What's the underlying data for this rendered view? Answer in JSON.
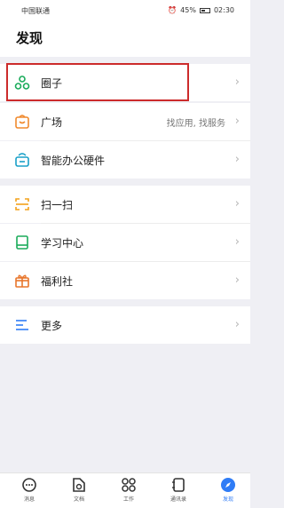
{
  "status_bar": {
    "carrier": "中国联通",
    "battery": "45%",
    "time": "02:30"
  },
  "header": {
    "title": "发现"
  },
  "items": [
    {
      "label": "圈子",
      "icon": "circle-group-icon",
      "color": "#1aab5a"
    },
    {
      "label": "广场",
      "icon": "square-bag-icon",
      "color": "#f08a2e",
      "hint": "找应用, 找服务"
    },
    {
      "label": "智能办公硬件",
      "icon": "smart-hardware-icon",
      "color": "#1aa0c8"
    },
    {
      "label": "扫一扫",
      "icon": "scan-icon",
      "color": "#f3a21b"
    },
    {
      "label": "学习中心",
      "icon": "book-icon",
      "color": "#1aab5a"
    },
    {
      "label": "福利社",
      "icon": "gift-icon",
      "color": "#e8762c"
    },
    {
      "label": "更多",
      "icon": "more-lines-icon",
      "color": "#2f7cf6"
    }
  ],
  "tabbar": {
    "tabs": [
      {
        "label": "消息",
        "icon": "message-icon"
      },
      {
        "label": "文档",
        "icon": "document-icon"
      },
      {
        "label": "工作",
        "icon": "work-grid-icon"
      },
      {
        "label": "通讯录",
        "icon": "contacts-icon"
      },
      {
        "label": "发现",
        "icon": "discover-compass-icon",
        "active": true
      }
    ],
    "active_color": "#2f7cf6"
  }
}
